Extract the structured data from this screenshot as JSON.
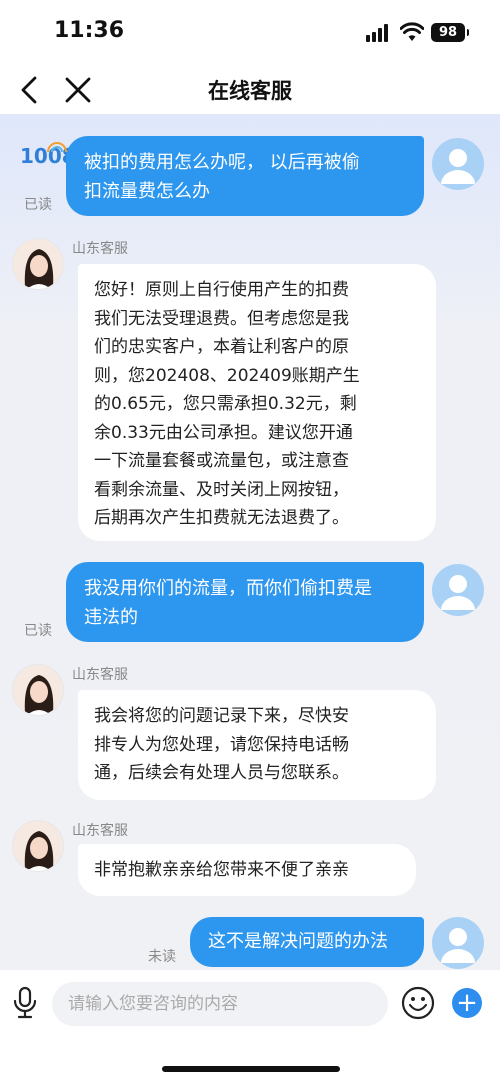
{
  "status_bar": {
    "time": "11:36",
    "battery": "98"
  },
  "nav": {
    "title": "在线客服"
  },
  "logo_text": "1008",
  "messages": [
    {
      "side": "out",
      "lines": [
        "被扣的费用怎么办呢， 以后再被偷",
        "扣流量费怎么办"
      ],
      "status": "已读"
    },
    {
      "side": "in",
      "sender": "山东客服",
      "lines": [
        "您好！原则上自行使用产生的扣费",
        "我们无法受理退费。但考虑您是我",
        "们的忠实客户，本着让利客户的原",
        "则，您202408、202409账期产生",
        "的0.65元，您只需承担0.32元，剩",
        "余0.33元由公司承担。建议您开通",
        "一下流量套餐或流量包，或注意查",
        "看剩余流量、及时关闭上网按钮，",
        "后期再次产生扣费就无法退费了。"
      ]
    },
    {
      "side": "out",
      "lines": [
        "我没用你们的流量，而你们偷扣费是",
        "违法的"
      ],
      "status": "已读"
    },
    {
      "side": "in",
      "sender": "山东客服",
      "lines": [
        "我会将您的问题记录下来，尽快安",
        "排专人为您处理，请您保持电话畅",
        "通，后续会有处理人员与您联系。"
      ]
    },
    {
      "side": "in",
      "sender": "山东客服",
      "lines": [
        "非常抱歉亲亲给您带来不便了亲亲"
      ]
    },
    {
      "side": "out",
      "lines": [
        "这不是解决问题的办法"
      ],
      "status": "未读"
    }
  ],
  "input": {
    "placeholder": "请输入您要咨询的内容"
  },
  "icons": [
    "back-icon",
    "close-icon",
    "mic-icon",
    "emoji-icon",
    "plus-icon"
  ],
  "colors": {
    "out_bubble": "#2d96ee",
    "in_bubble": "#ffffff",
    "accent": "#2d8ef0"
  }
}
